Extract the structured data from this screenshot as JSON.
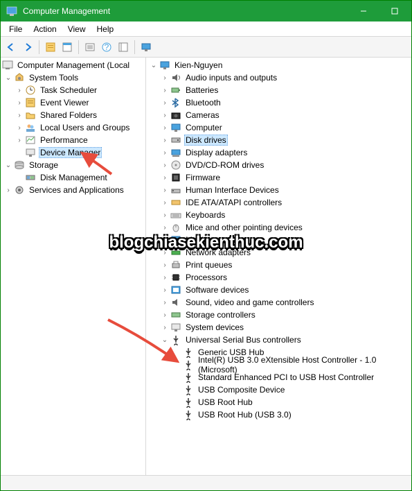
{
  "window": {
    "title": "Computer Management",
    "watermark": "blogchiasekienthuc.com"
  },
  "menu": [
    "File",
    "Action",
    "View",
    "Help"
  ],
  "leftTree": {
    "root": "Computer Management (Local",
    "systemTools": "System Tools",
    "taskScheduler": "Task Scheduler",
    "eventViewer": "Event Viewer",
    "sharedFolders": "Shared Folders",
    "localUsers": "Local Users and Groups",
    "performance": "Performance",
    "deviceManager": "Device Manager",
    "storage": "Storage",
    "diskManagement": "Disk Management",
    "services": "Services and Applications"
  },
  "rightTree": {
    "root": "Kien-Nguyen",
    "audio": "Audio inputs and outputs",
    "batteries": "Batteries",
    "bluetooth": "Bluetooth",
    "cameras": "Cameras",
    "computer": "Computer",
    "diskDrives": "Disk drives",
    "displayAdapters": "Display adapters",
    "dvd": "DVD/CD-ROM drives",
    "firmware": "Firmware",
    "hid": "Human Interface Devices",
    "ide": "IDE ATA/ATAPI controllers",
    "keyboards": "Keyboards",
    "mice": "Mice and other pointing devices",
    "monitors": "Monitors",
    "networkAdapters": "Network adapters",
    "printQueues": "Print queues",
    "processors": "Processors",
    "softwareDevices": "Software devices",
    "sound": "Sound, video and game controllers",
    "storageControllers": "Storage controllers",
    "systemDevices": "System devices",
    "usb": "Universal Serial Bus controllers",
    "usbChildren": {
      "genericHub": "Generic USB Hub",
      "intel": "Intel(R) USB 3.0 eXtensible Host Controller - 1.0 (Microsoft)",
      "standard": "Standard Enhanced PCI to USB Host Controller",
      "composite": "USB Composite Device",
      "rootHub": "USB Root Hub",
      "rootHub3": "USB Root Hub (USB 3.0)"
    }
  }
}
